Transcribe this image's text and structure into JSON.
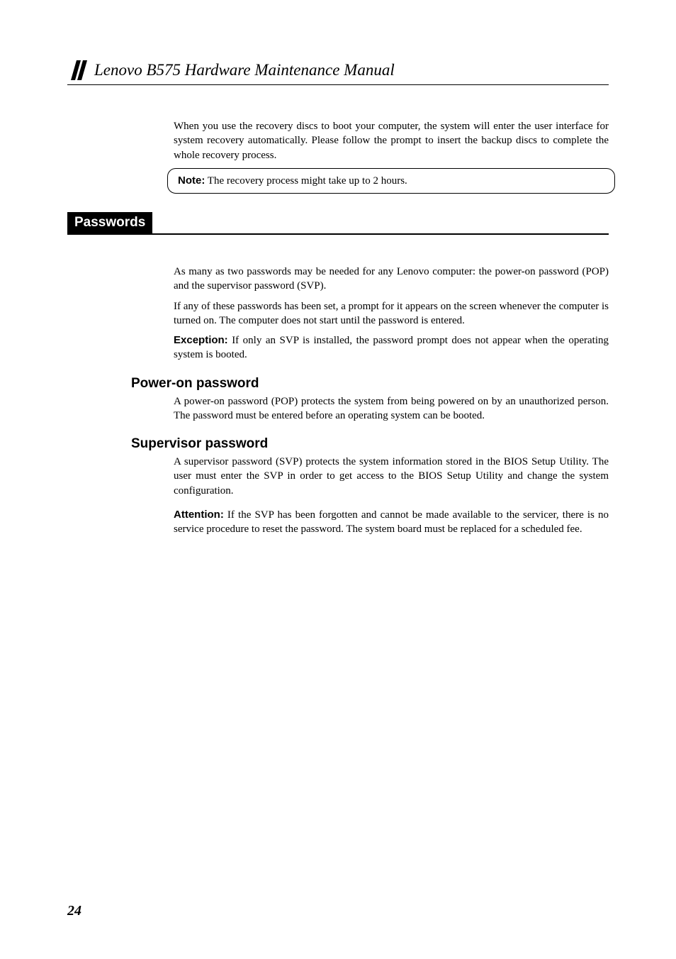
{
  "header": {
    "title": "Lenovo B575 Hardware Maintenance Manual"
  },
  "intro": {
    "p1": "When you use the recovery discs to boot your computer, the system will enter the user interface for system recovery automatically. Please follow the prompt to insert the backup discs to complete the whole recovery process.",
    "note_label": "Note:",
    "note_text": " The recovery process might take up to 2 hours."
  },
  "section": {
    "title": "Passwords",
    "p1": "As many as two passwords may be needed for any Lenovo computer: the power-on password (POP) and the supervisor password (SVP).",
    "p2": "If any of these passwords has been set, a prompt for it appears on the screen whenever the computer is turned on. The computer does not start until the password is entered.",
    "exception_label": "Exception:",
    "exception_text": " If only an SVP is installed, the password prompt does not appear when the operating system is booted."
  },
  "subsection1": {
    "heading": "Power-on password",
    "p1": "A power-on password (POP) protects the system from being powered on by an unauthorized person. The password must be entered before an operating system can be booted."
  },
  "subsection2": {
    "heading": "Supervisor password",
    "p1": "A supervisor password (SVP) protects the system information stored in the BIOS Setup Utility. The user must enter the SVP in order to get access to the BIOS Setup Utility and change the system configuration.",
    "attention_label": "Attention:",
    "attention_text": " If the SVP has been forgotten and cannot be made available to the servicer, there is no service procedure to reset the password. The system board must be replaced for a scheduled fee."
  },
  "page_number": "24"
}
